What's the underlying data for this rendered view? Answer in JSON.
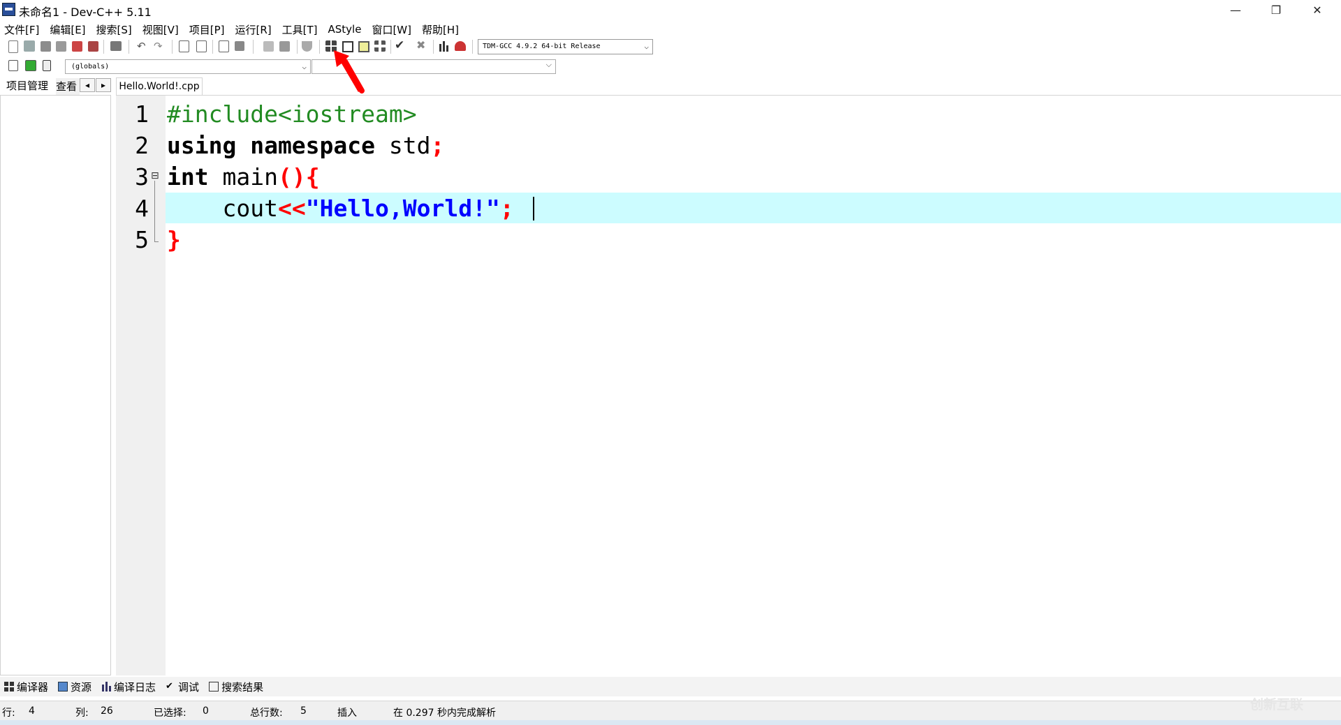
{
  "window": {
    "title": "未命名1 - Dev-C++ 5.11",
    "minimize": "—",
    "restore": "❐",
    "close": "✕"
  },
  "menu": [
    "文件[F]",
    "编辑[E]",
    "搜索[S]",
    "视图[V]",
    "项目[P]",
    "运行[R]",
    "工具[T]",
    "AStyle",
    "窗口[W]",
    "帮助[H]"
  ],
  "toolbar": {
    "compiler": "TDM-GCC 4.9.2 64-bit Release",
    "globals": "(globals)",
    "symbol": ""
  },
  "left_panel": {
    "tab_project": "项目管理",
    "tab_view": "查看",
    "nav_prev": "◂",
    "nav_next": "▸"
  },
  "editor": {
    "tab_label": "Hello.World!.cpp",
    "line_numbers": [
      "1",
      "2",
      "3",
      "4",
      "5"
    ],
    "fold_marker": "⊟",
    "code": {
      "l1": "#include<iostream>",
      "l2_kw": "using namespace",
      "l2_id": " std",
      "l2_sym": ";",
      "l3_kw": "int",
      "l3_id": " main",
      "l3_sym": "(){",
      "l4_indent": "    cout",
      "l4_op": "<<",
      "l4_str": "\"Hello,World!\"",
      "l4_end": ";",
      "l5": "}"
    }
  },
  "bottom_tabs": [
    "编译器",
    "资源",
    "编译日志",
    "调试",
    "搜索结果"
  ],
  "status": {
    "row_label": "行:",
    "row_value": "4",
    "col_label": "列:",
    "col_value": "26",
    "sel_label": "已选择:",
    "sel_value": "0",
    "lines_label": "总行数:",
    "lines_value": "5",
    "mode": "插入",
    "parse_msg": "在 0.297 秒内完成解析"
  },
  "watermark": "创新互联",
  "colors": {
    "preprocessor": "#228b22",
    "symbol": "#ff0000",
    "string": "#0000ff",
    "current_line": "#ccfcff",
    "annotation_arrow": "#ff0000"
  }
}
